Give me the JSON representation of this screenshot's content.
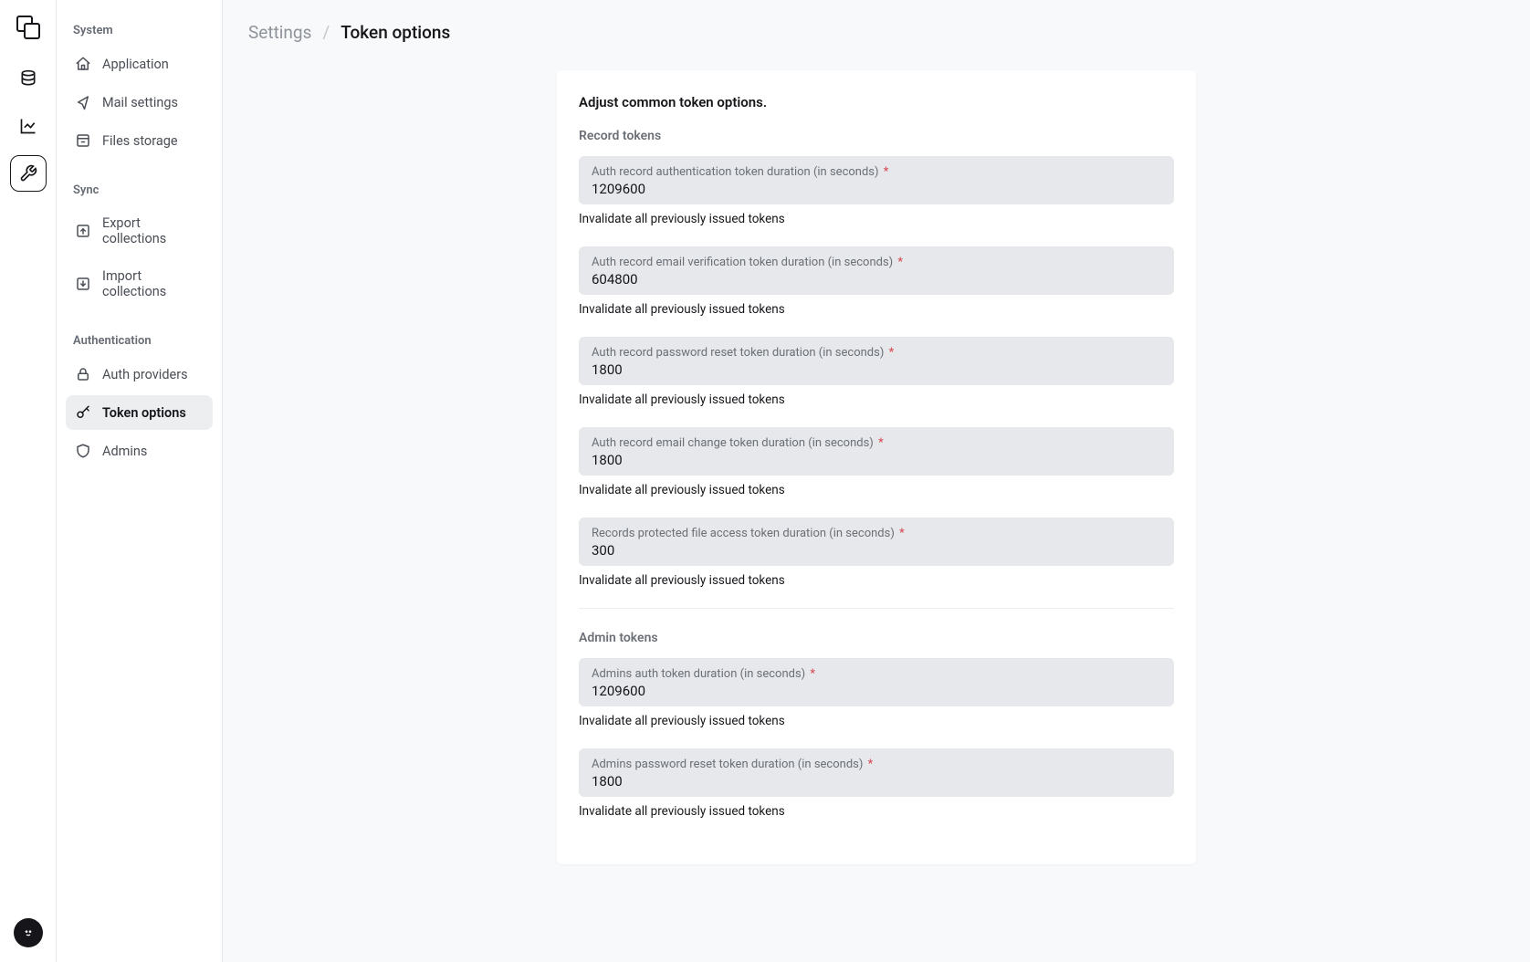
{
  "breadcrumb": {
    "parent": "Settings",
    "current": "Token options"
  },
  "sidebar": {
    "sections": [
      {
        "title": "System",
        "items": [
          {
            "label": "Application",
            "icon": "home",
            "active": false
          },
          {
            "label": "Mail settings",
            "icon": "send",
            "active": false
          },
          {
            "label": "Files storage",
            "icon": "archive",
            "active": false
          }
        ]
      },
      {
        "title": "Sync",
        "items": [
          {
            "label": "Export collections",
            "icon": "upload",
            "active": false
          },
          {
            "label": "Import collections",
            "icon": "download",
            "active": false
          }
        ]
      },
      {
        "title": "Authentication",
        "items": [
          {
            "label": "Auth providers",
            "icon": "lock",
            "active": false
          },
          {
            "label": "Token options",
            "icon": "key",
            "active": true
          },
          {
            "label": "Admins",
            "icon": "shield",
            "active": false
          }
        ]
      }
    ]
  },
  "page": {
    "heading": "Adjust common token options.",
    "invalidate_label": "Invalidate all previously issued tokens",
    "groups": [
      {
        "title": "Record tokens",
        "fields": [
          {
            "label": "Auth record authentication token duration (in seconds)",
            "required": true,
            "value": "1209600"
          },
          {
            "label": "Auth record email verification token duration (in seconds)",
            "required": true,
            "value": "604800"
          },
          {
            "label": "Auth record password reset token duration (in seconds)",
            "required": true,
            "value": "1800"
          },
          {
            "label": "Auth record email change token duration (in seconds)",
            "required": true,
            "value": "1800"
          },
          {
            "label": "Records protected file access token duration (in seconds)",
            "required": true,
            "value": "300"
          }
        ]
      },
      {
        "title": "Admin tokens",
        "fields": [
          {
            "label": "Admins auth token duration (in seconds)",
            "required": true,
            "value": "1209600"
          },
          {
            "label": "Admins password reset token duration (in seconds)",
            "required": true,
            "value": "1800"
          }
        ]
      }
    ]
  }
}
